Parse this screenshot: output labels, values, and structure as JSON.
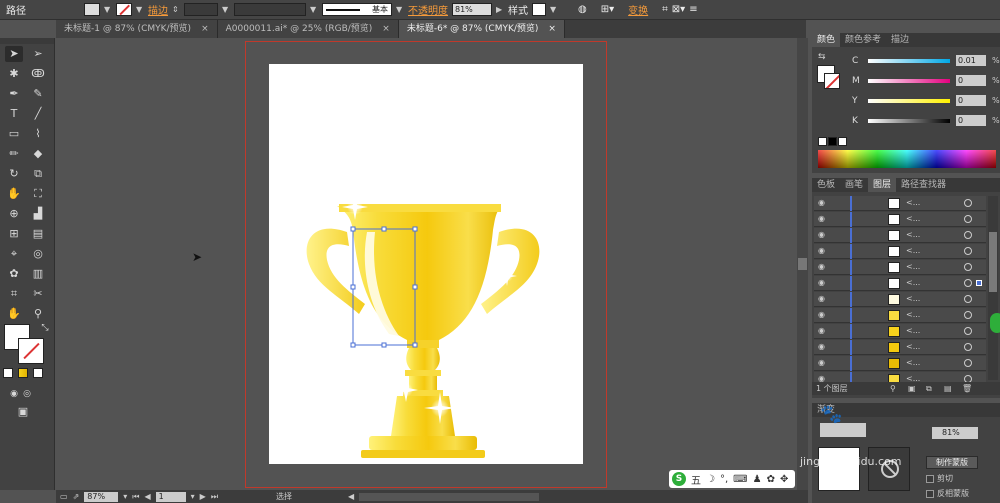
{
  "control_bar": {
    "object_label": "路径",
    "stroke_label": "描边",
    "stroke_style": "基本",
    "opacity_label": "不透明度",
    "opacity_value": "81%",
    "style_label": "样式",
    "transform_label": "变换"
  },
  "tabs": [
    {
      "label": "未标题-1 @ 87% (CMYK/预览)",
      "close": "×"
    },
    {
      "label": "A0000011.ai* @ 25% (RGB/预览)",
      "close": "×"
    },
    {
      "label": "未标题-6* @ 87% (CMYK/预览)",
      "close": "×"
    }
  ],
  "color_panel": {
    "tabs": [
      "颜色",
      "颜色参考",
      "描边"
    ],
    "channels": [
      {
        "key": "C",
        "value": "0.01",
        "unit": "%"
      },
      {
        "key": "M",
        "value": "0",
        "unit": "%"
      },
      {
        "key": "Y",
        "value": "0",
        "unit": "%"
      },
      {
        "key": "K",
        "value": "0",
        "unit": "%"
      }
    ]
  },
  "layers_panel": {
    "tabs": [
      "色板",
      "画笔",
      "图层",
      "路径查找器"
    ],
    "footer": "1 个图层",
    "row_label": "<..."
  },
  "transparency_panel": {
    "tab": "渐变",
    "opacity_value": "81%",
    "make_mask_label": "制作蒙版",
    "clip_label": "剪切",
    "invert_mask_label": "反相蒙版"
  },
  "status_bar": {
    "zoom": "87%",
    "page": "1",
    "tool_label": "选择"
  },
  "ime_bar": {
    "logo": "S",
    "mode": "五"
  },
  "watermark": "jingyan.baidu.com",
  "colors": {
    "gold_light": "#fff06a",
    "gold_mid": "#f7d21c",
    "gold_dark": "#e3b400",
    "selection_blue": "#4a6fd4",
    "accent_orange": "#f59a3a"
  }
}
